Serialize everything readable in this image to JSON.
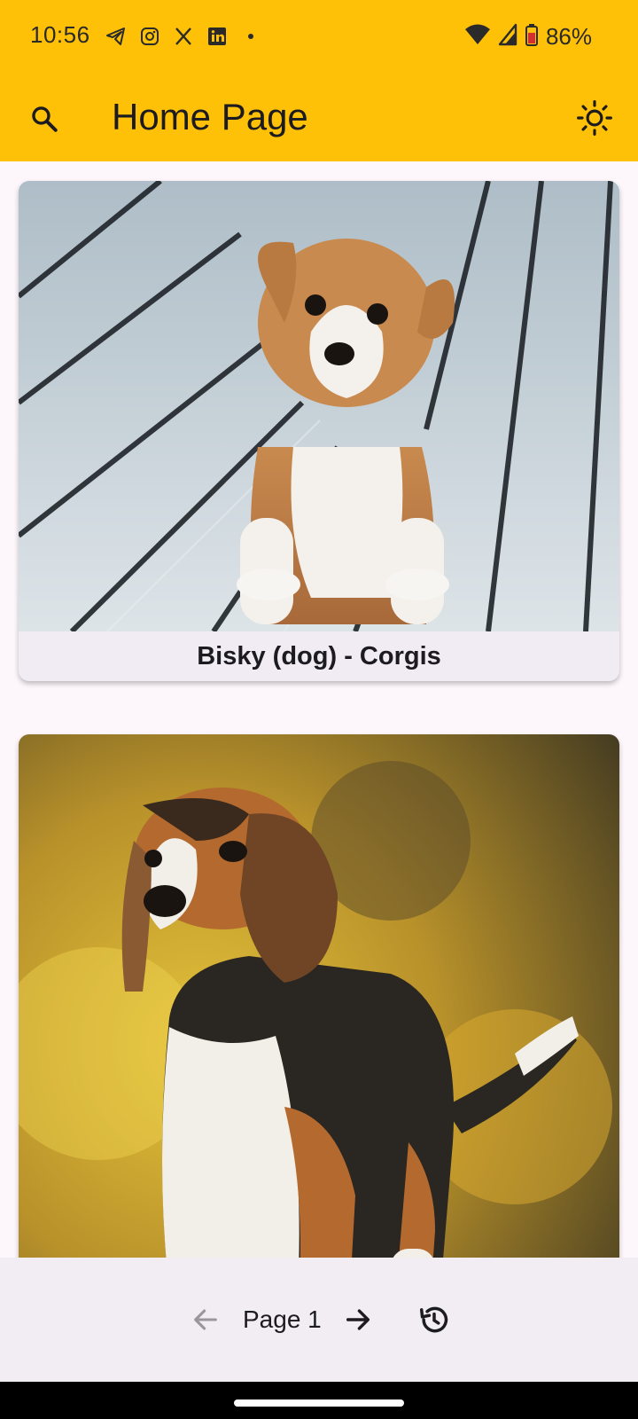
{
  "status": {
    "time": "10:56",
    "battery": "86%",
    "left_icons": [
      "telegram-icon",
      "instagram-icon",
      "x-icon",
      "linkedin-icon",
      "dot-icon"
    ],
    "right_icons": [
      "wifi-icon",
      "signal-icon",
      "battery-icon"
    ]
  },
  "appbar": {
    "title": "Home Page",
    "accent": "#ffc107",
    "search_icon": "search-icon",
    "theme_icon": "sun-icon"
  },
  "cards": [
    {
      "caption": "Bisky (dog) - Corgis",
      "image": "corgi puppy photo"
    },
    {
      "caption": "",
      "image": "beagle puppy photo"
    }
  ],
  "pager": {
    "label": "Page 1",
    "prev_icon": "arrow-left-icon",
    "next_icon": "arrow-right-icon",
    "history_icon": "history-icon"
  }
}
